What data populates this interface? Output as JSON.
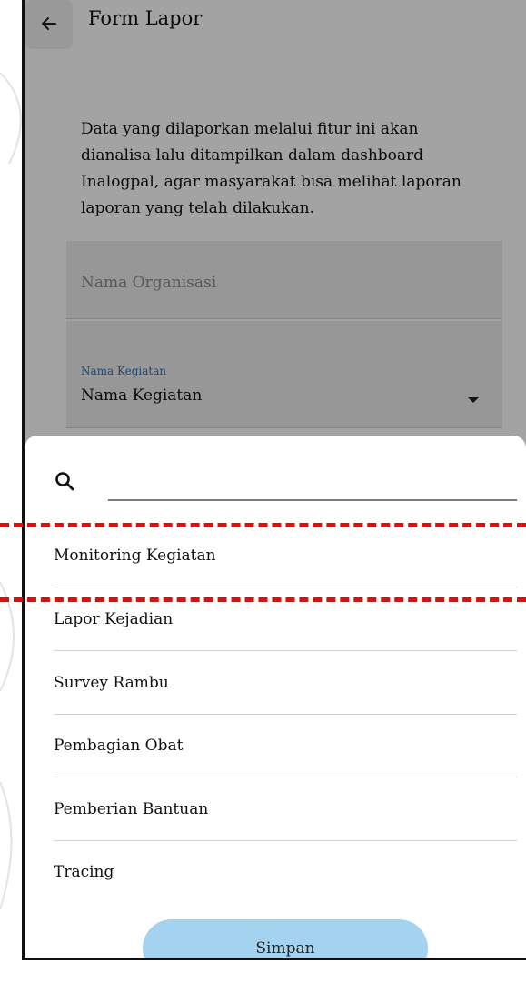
{
  "header": {
    "title": "Form Lapor"
  },
  "description": "Data yang dilaporkan melalui fitur ini akan dianalisa lalu ditampilkan dalam dashboard Inalogpal, agar masyarakat bisa melihat laporan laporan yang telah dilakukan.",
  "form": {
    "organization_placeholder": "Nama Organisasi",
    "activity_label": "Nama Kegiatan",
    "activity_value": "Nama Kegiatan"
  },
  "sheet": {
    "search_placeholder": "",
    "options": [
      "Monitoring Kegiatan",
      "Lapor Kejadian",
      "Survey Rambu",
      "Pembagian Obat",
      "Pemberian Bantuan",
      "Tracing"
    ],
    "save_label": "Simpan"
  },
  "colors": {
    "highlight": "#ff0000",
    "save_button": "#a3d3ee",
    "label_accent": "#2f6fb1"
  }
}
